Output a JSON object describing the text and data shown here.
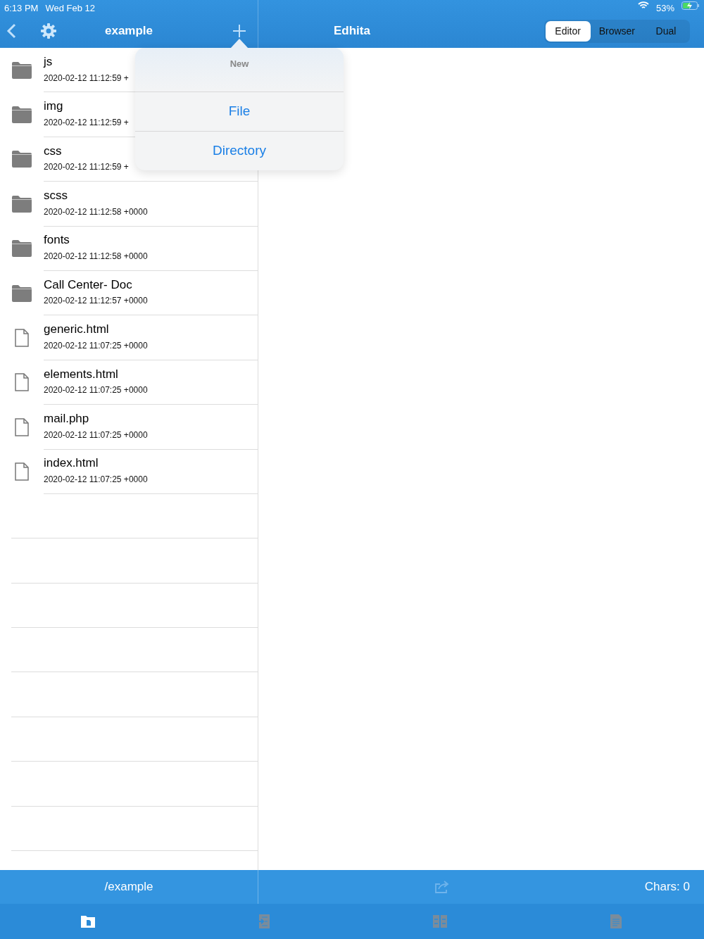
{
  "status_bar": {
    "time": "6:13 PM",
    "date": "Wed Feb 12",
    "battery": "53%",
    "charging": true
  },
  "left_nav": {
    "title": "example"
  },
  "right_nav": {
    "title": "Edhita",
    "segments": [
      {
        "label": "Editor",
        "selected": true
      },
      {
        "label": "Browser",
        "selected": false
      },
      {
        "label": "Dual",
        "selected": false
      }
    ]
  },
  "files": [
    {
      "name": "js",
      "date": "2020-02-12 11:12:59 +",
      "kind": "folder"
    },
    {
      "name": "img",
      "date": "2020-02-12 11:12:59 +",
      "kind": "folder"
    },
    {
      "name": "css",
      "date": "2020-02-12 11:12:59 +",
      "kind": "folder"
    },
    {
      "name": "scss",
      "date": "2020-02-12 11:12:58 +0000",
      "kind": "folder"
    },
    {
      "name": "fonts",
      "date": "2020-02-12 11:12:58 +0000",
      "kind": "folder"
    },
    {
      "name": "Call Center- Doc",
      "date": "2020-02-12 11:12:57 +0000",
      "kind": "folder"
    },
    {
      "name": "generic.html",
      "date": "2020-02-12 11:07:25 +0000",
      "kind": "file"
    },
    {
      "name": "elements.html",
      "date": "2020-02-12 11:07:25 +0000",
      "kind": "file"
    },
    {
      "name": "mail.php",
      "date": "2020-02-12 11:07:25 +0000",
      "kind": "file"
    },
    {
      "name": "index.html",
      "date": "2020-02-12 11:07:25 +0000",
      "kind": "file"
    }
  ],
  "popover": {
    "title": "New",
    "actions": [
      "File",
      "Directory"
    ]
  },
  "path_bar": {
    "path": "/example",
    "chars": "Chars: 0"
  },
  "tabs": [
    {
      "kind": "files",
      "selected": true
    },
    {
      "kind": "editor",
      "selected": false
    },
    {
      "kind": "dual",
      "selected": false
    },
    {
      "kind": "document",
      "selected": false
    }
  ]
}
